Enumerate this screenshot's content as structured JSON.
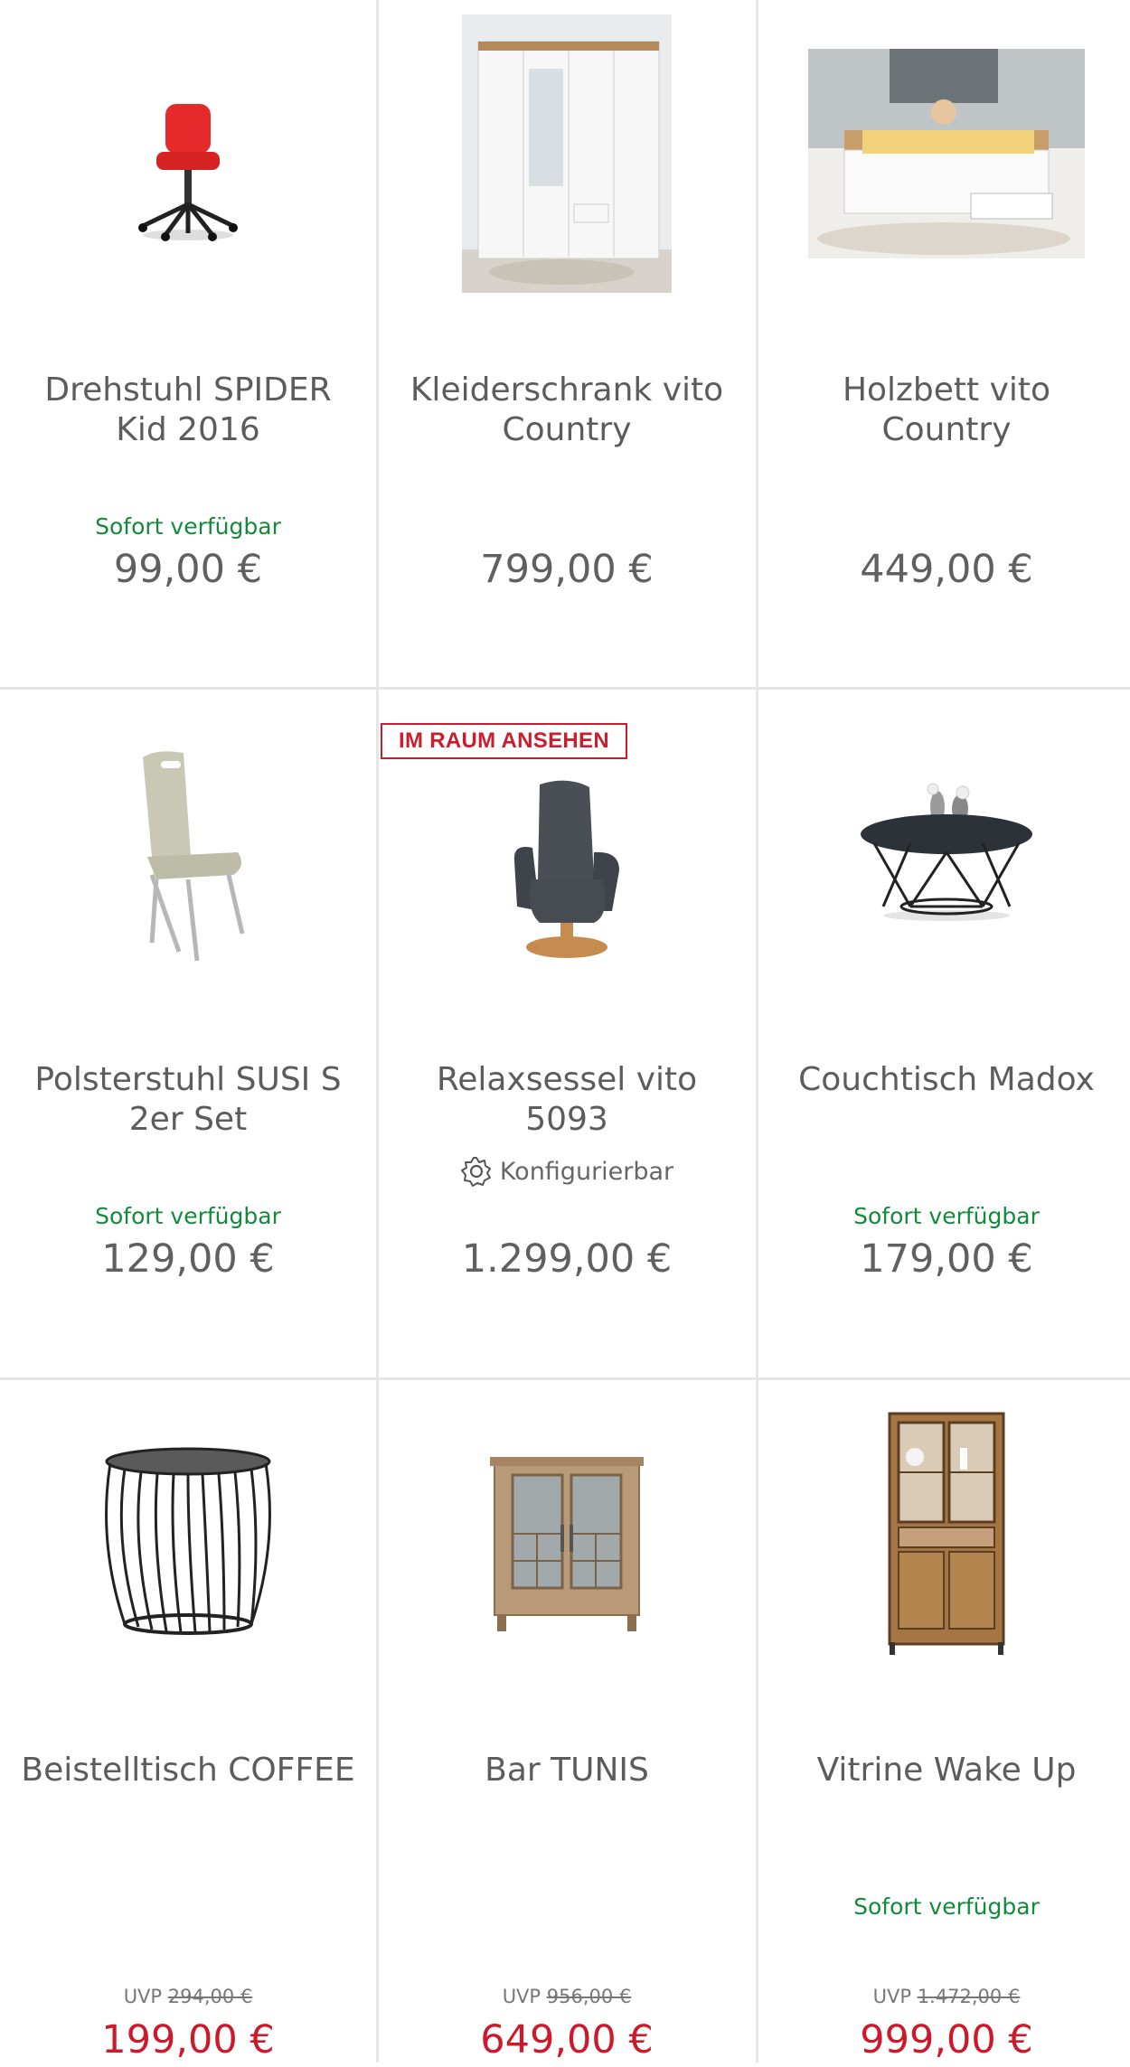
{
  "products": [
    {
      "title": "Drehstuhl SPIDER Kid 2016",
      "availability": "Sofort verfügbar",
      "price": "99,00 €",
      "image": "red-office-chair"
    },
    {
      "title": "Kleiderschrank vito Country",
      "availability": "",
      "price": "799,00 €",
      "image": "white-wardrobe"
    },
    {
      "title": "Holzbett vito Country",
      "availability": "",
      "price": "449,00 €",
      "image": "white-bed-room"
    },
    {
      "title": "Polsterstuhl SUSI S 2er Set",
      "availability": "Sofort verfügbar",
      "price": "129,00 €",
      "image": "beige-upholstered-chair"
    },
    {
      "title": "Relaxsessel vito 5093",
      "badge": "IM RAUM ANSEHEN",
      "config": "Konfigurierbar",
      "availability": "",
      "price": "1.299,00 €",
      "image": "grey-recliner"
    },
    {
      "title": "Couchtisch Madox",
      "availability": "Sofort verfügbar",
      "price": "179,00 €",
      "image": "glass-wire-coffee-table"
    },
    {
      "title": "Beistelltisch COFFEE",
      "availability": "",
      "uvp_label": "UVP",
      "uvp": "294,00 €",
      "price": "199,00 €",
      "image": "wire-side-table"
    },
    {
      "title": "Bar TUNIS",
      "availability": "",
      "uvp_label": "UVP",
      "uvp": "956,00 €",
      "price": "649,00 €",
      "image": "wood-bar-cabinet"
    },
    {
      "title": "Vitrine Wake Up",
      "availability": "Sofort verfügbar",
      "uvp_label": "UVP",
      "uvp": "1.472,00 €",
      "price": "999,00 €",
      "image": "wood-glass-vitrine"
    }
  ],
  "colors": {
    "available": "#138a3a",
    "sale": "#cc1a2a",
    "badge": "#c81e2d",
    "divider": "#e6e6e6"
  }
}
